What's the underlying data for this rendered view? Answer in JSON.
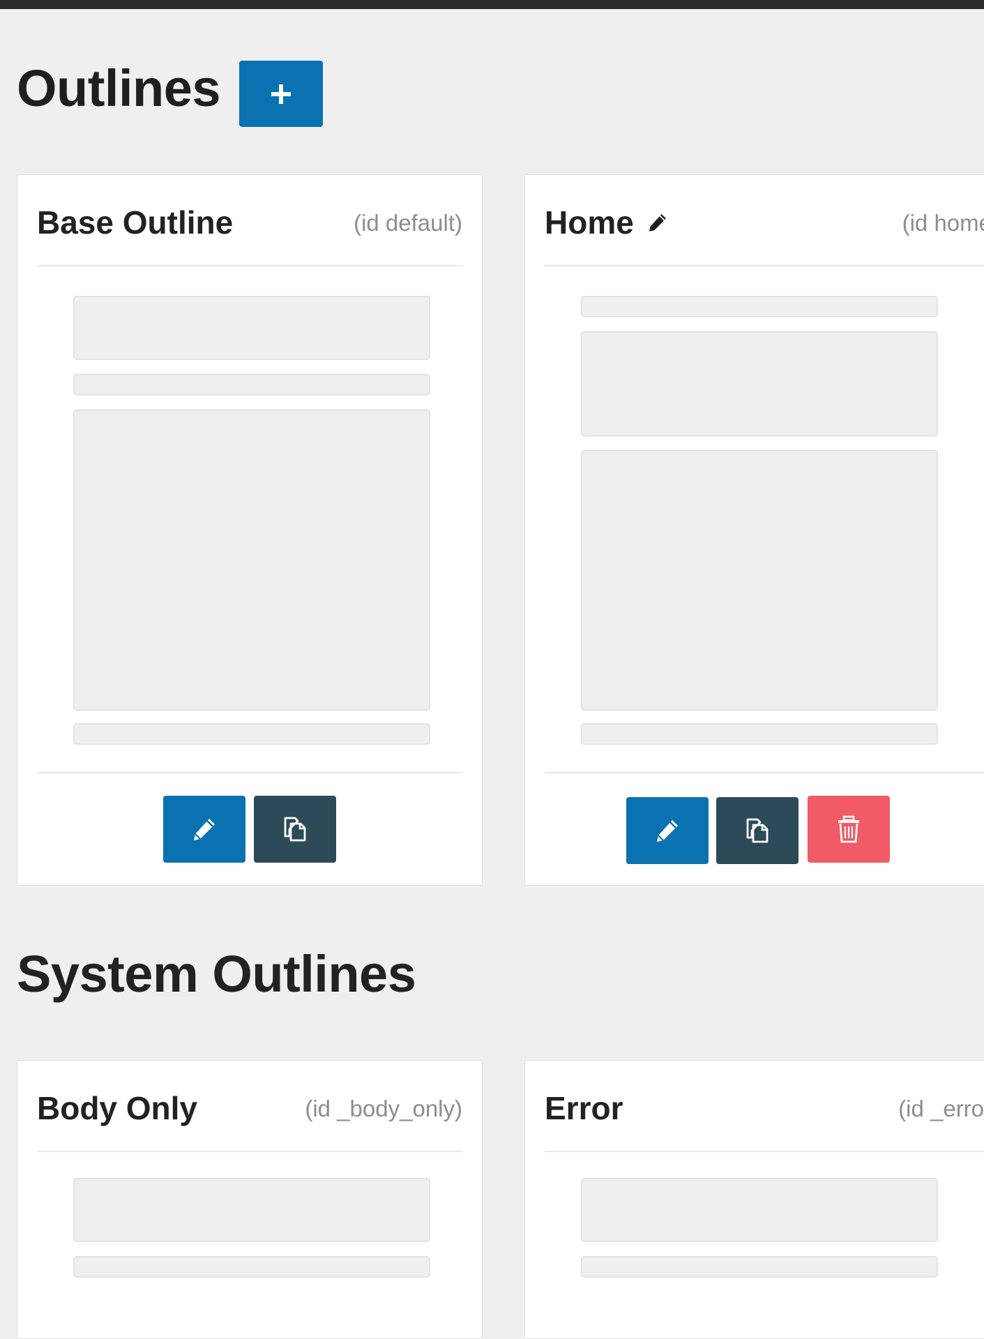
{
  "header": {
    "title": "Outlines",
    "add_icon": "plus-icon"
  },
  "cards": [
    {
      "title": "Base Outline",
      "id_label": "(id default)",
      "title_icon": null
    },
    {
      "title": "Home",
      "id_label": "(id home)",
      "title_icon": "pencil-icon"
    },
    {
      "title": "Body Only",
      "id_label": "(id _body_only)",
      "title_icon": null
    },
    {
      "title": "Error",
      "id_label": "(id _error)",
      "title_icon": null
    }
  ],
  "system_section": {
    "title": "System Outlines"
  },
  "icons": {
    "edit": "pencil-icon",
    "duplicate": "copy-icon",
    "delete": "trash-icon"
  },
  "colors": {
    "primary": "#0a72b0",
    "dark": "#2d4a58",
    "danger": "#f05b66",
    "background": "#efefef"
  }
}
